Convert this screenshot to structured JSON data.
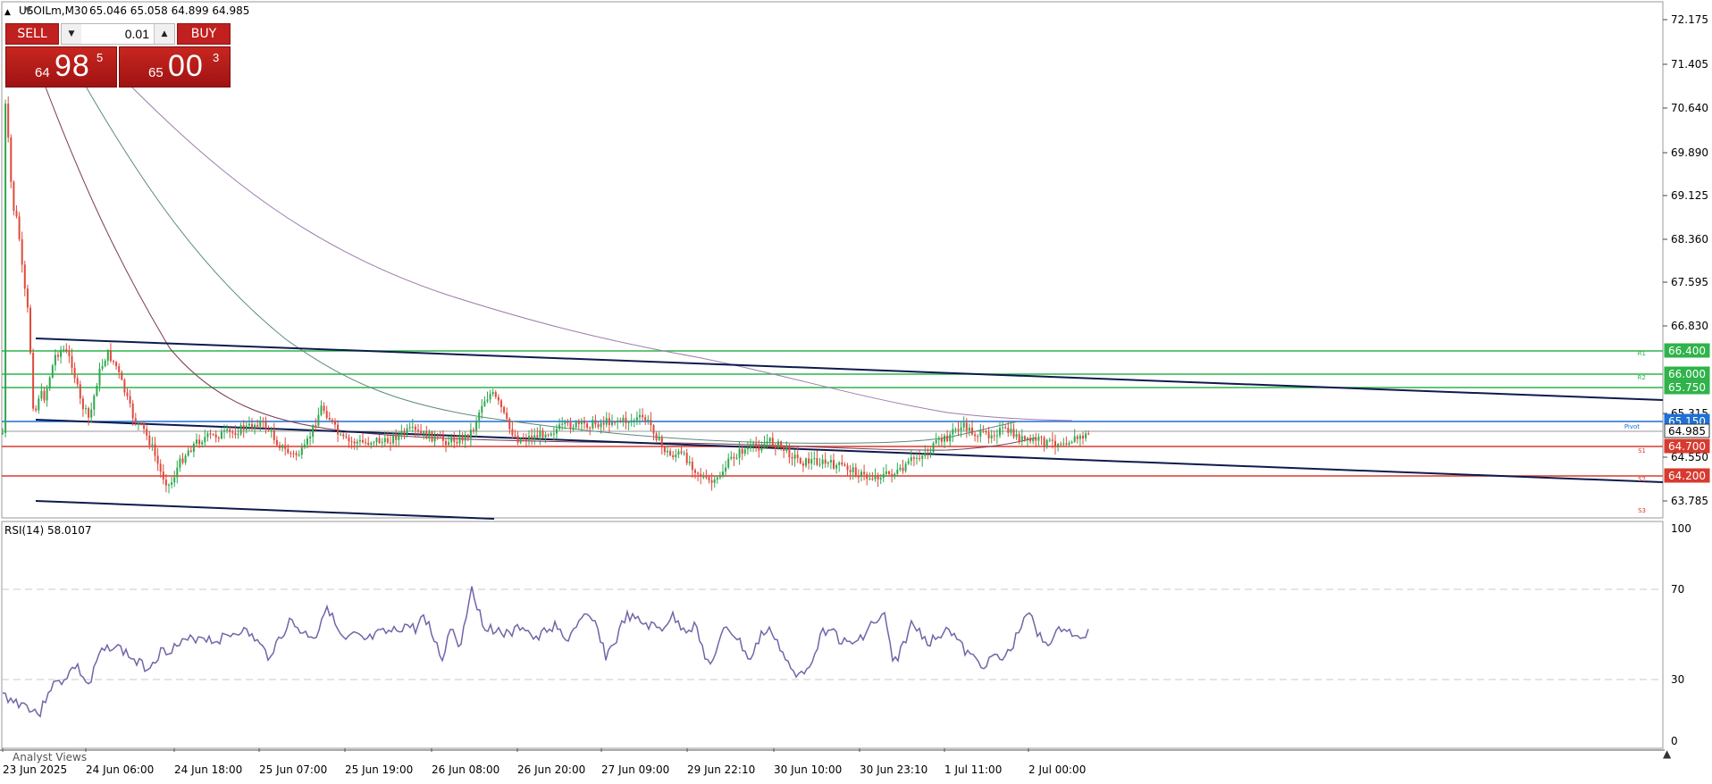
{
  "header": {
    "symbol": "USOILm,M30",
    "ohlc": "65.046 65.058 64.899 64.985"
  },
  "trade": {
    "sell_label": "SELL",
    "buy_label": "BUY",
    "lot": "0.01",
    "sell_price_small": "64",
    "sell_price_big": "98",
    "sell_price_sup": "5",
    "buy_price_small": "65",
    "buy_price_big": "00",
    "buy_price_sup": "3"
  },
  "price_axis": {
    "ticks": [
      "72.175",
      "71.405",
      "70.640",
      "69.890",
      "69.125",
      "68.360",
      "67.595",
      "66.830",
      "65.315",
      "64.550",
      "63.785"
    ],
    "tags": [
      {
        "label": "66.400",
        "color": "#2fb34a"
      },
      {
        "label": "66.000",
        "color": "#2fb34a"
      },
      {
        "label": "65.750",
        "color": "#2fb34a"
      },
      {
        "label": "65.150",
        "color": "#1f6fd6"
      },
      {
        "label": "64.985",
        "color": "#ffffff"
      },
      {
        "label": "64.700",
        "color": "#d83a2f"
      },
      {
        "label": "64.200",
        "color": "#d83a2f"
      }
    ],
    "small_labels": [
      {
        "label": "R1",
        "color": "#2fb34a"
      },
      {
        "label": "R2",
        "color": "#2fb34a"
      },
      {
        "label": "Pivot",
        "color": "#1f6fd6"
      },
      {
        "label": "S1",
        "color": "#d83a2f"
      },
      {
        "label": "S2",
        "color": "#d83a2f"
      },
      {
        "label": "S3",
        "color": "#d83a2f"
      }
    ]
  },
  "rsi": {
    "label": "RSI(14) 58.0107",
    "ticks": [
      "100",
      "70",
      "30",
      "0"
    ]
  },
  "time_axis": {
    "labels": [
      "23 Jun 2025",
      "24 Jun 06:00",
      "24 Jun 18:00",
      "25 Jun 07:00",
      "25 Jun 19:00",
      "26 Jun 08:00",
      "26 Jun 20:00",
      "27 Jun 09:00",
      "29 Jun 22:10",
      "30 Jun 10:00",
      "30 Jun 23:10",
      "1 Jul 11:00",
      "2 Jul 00:00"
    ]
  },
  "footer": {
    "tab_label": "Analyst Views"
  },
  "colors": {
    "bull": "#2fa84f",
    "bear": "#e04a3c",
    "rsi_line": "#7463a8",
    "ma_fast": "#7a3a56",
    "ma_mid": "#5e8a7a",
    "ma_slow": "#9c7cae",
    "trendline": "#0d1b4d"
  }
}
